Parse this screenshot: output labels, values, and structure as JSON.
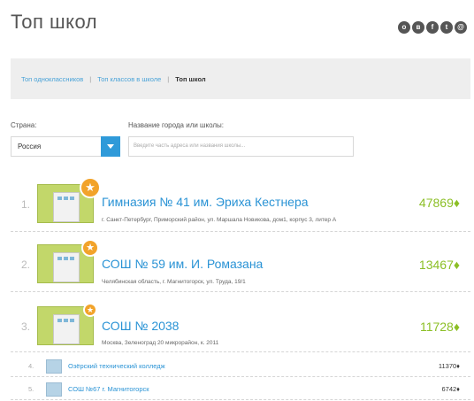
{
  "page": {
    "title": "Топ школ"
  },
  "social_icons": [
    "odnoklassniki-icon",
    "vk-icon",
    "facebook-icon",
    "twitter-icon",
    "mail-icon"
  ],
  "breadcrumb": {
    "items": [
      {
        "label": "Топ одноклассников"
      },
      {
        "label": "Топ классов в школе"
      },
      {
        "label": "Топ школ"
      }
    ],
    "separator": "|"
  },
  "filters": {
    "country_label": "Страна:",
    "country_value": "Россия",
    "city_label": "Название города или школы:",
    "city_placeholder": "Введите часть адреса или названия школы..."
  },
  "top_schools": [
    {
      "rank": "1.",
      "name": "Гимназия № 41 им. Эриха Кестнера",
      "address": "г. Санкт-Петербург, Приморский район, ул. Маршала Новикова, дом1, корпус 3, литер А",
      "score": "47869♦",
      "badge": "★"
    },
    {
      "rank": "2.",
      "name": "СОШ № 59 им. И. Ромазана",
      "address": "Челябинская область, г. Магнитогорск, ул. Труда, 19/1",
      "score": "13467♦",
      "badge": "★"
    },
    {
      "rank": "3.",
      "name": "СОШ № 2038",
      "address": "Москва, Зеленоград 20 микрорайон, к. 2011",
      "score": "11728♦",
      "badge": "★"
    }
  ],
  "other_schools": [
    {
      "rank": "4.",
      "name": "Озёрский технический колледж",
      "score": "11370♦"
    },
    {
      "rank": "5.",
      "name": "СОШ №67 г. Магнитогорск",
      "score": "6742♦"
    }
  ],
  "colors": {
    "accent": "#2a93d5",
    "score": "#8cbf26",
    "badge": "#f2a32a"
  }
}
